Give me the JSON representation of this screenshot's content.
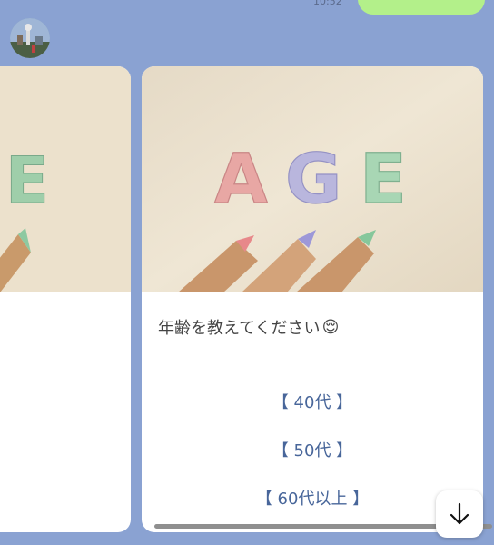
{
  "header": {
    "time": "10:52"
  },
  "cards": {
    "left": {
      "options": [
        "】",
        "】"
      ]
    },
    "main": {
      "image_text": "AGE",
      "question": "年齢を教えてください",
      "emoji": "😌",
      "options": [
        "【 40代 】",
        "【 50代 】",
        "【 60代以上 】"
      ]
    }
  },
  "colors": {
    "background": "#8aa2d2",
    "option_text": "#48669a",
    "sent_bubble": "#b3f08a"
  },
  "icons": {
    "scroll_down": "arrow-down-icon"
  }
}
